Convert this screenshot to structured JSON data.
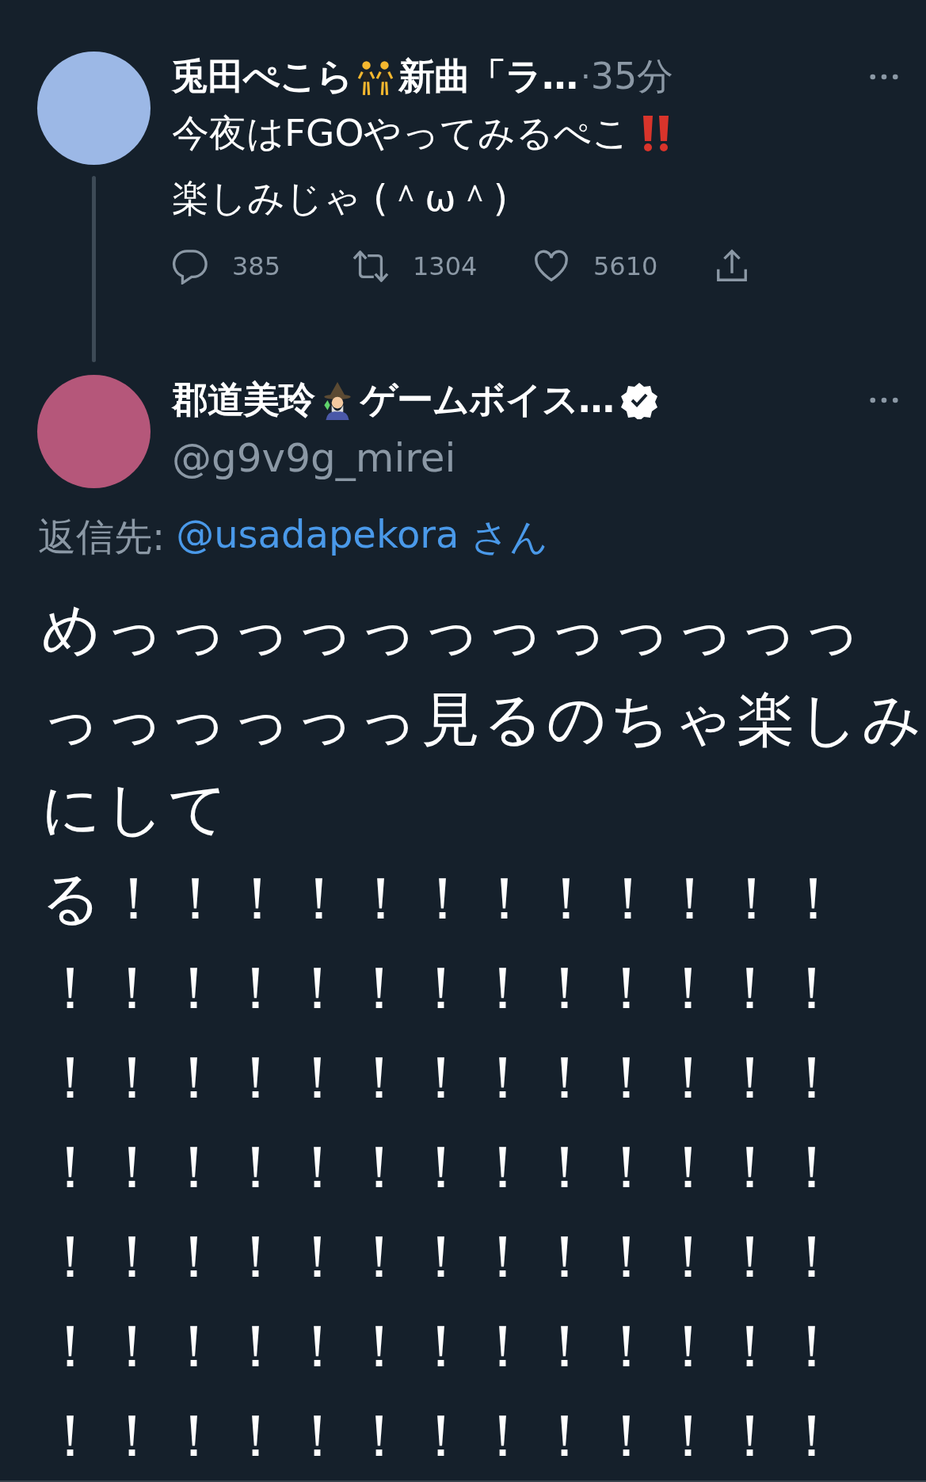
{
  "parent_tweet": {
    "name_start": "兎田ぺこら",
    "name_end": "新曲「ラ…",
    "separator": "·",
    "time": "35分",
    "text_lines": [
      "今夜はFGOやってみるぺこ",
      "楽しみじゃ (＾ω＾)"
    ],
    "stats": [
      {
        "kind": "reply",
        "count": "385"
      },
      {
        "kind": "retweet",
        "count": "1304"
      },
      {
        "kind": "like",
        "count": "5610"
      },
      {
        "kind": "share"
      }
    ]
  },
  "reply_tweet": {
    "name_start": "郡道美玲",
    "name_end": "ゲームボイス…",
    "verified": true,
    "handle": "@g9v9g_mirei",
    "reply_label": "返信先:",
    "reply_to": "@usadapekora",
    "reply_suffix": "さん",
    "body_lines": [
      "めっっっっっっっっっっっっ",
      "っっっっっっ見るのちゃ楽しみ",
      "にして",
      "る！！！！！！！！！！！！",
      "！！！！！！！！！！！！！",
      "！！！！！！！！！！！！！",
      "！！！！！！！！！！！！！",
      "！！！！！！！！！！！！！",
      "！！！！！！！！！！！！！",
      "！！！！！！！！！！！！！"
    ]
  }
}
